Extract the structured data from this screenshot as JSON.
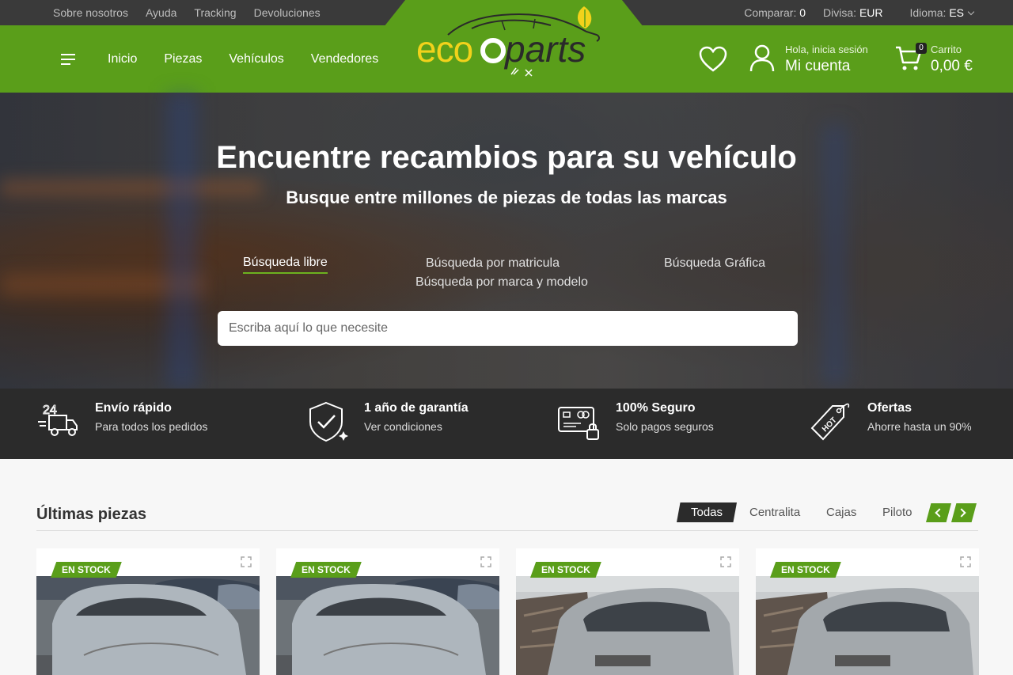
{
  "topbar": {
    "links": [
      "Sobre nosotros",
      "Ayuda",
      "Tracking",
      "Devoluciones"
    ],
    "compare_label": "Comparar:",
    "compare_value": "0",
    "currency_label": "Divisa:",
    "currency_value": "EUR",
    "language_label": "Idioma:",
    "language_value": "ES"
  },
  "header": {
    "nav": [
      "Inicio",
      "Piezas",
      "Vehículos",
      "Vendedores"
    ],
    "logo_text": "ecooparts",
    "account_small": "Hola, inicia sesión",
    "account_big": "Mi cuenta",
    "cart_count": "0",
    "cart_small": "Carrito",
    "cart_total": "0,00 €"
  },
  "hero": {
    "title": "Encuentre recambios para su vehículo",
    "subtitle": "Busque entre millones de piezas de todas las marcas",
    "tabs": [
      "Búsqueda libre",
      "Búsqueda por matricula",
      "Búsqueda por marca y modelo",
      "Búsqueda Gráfica"
    ],
    "search_placeholder": "Escriba aquí lo que necesite"
  },
  "features": [
    {
      "title": "Envío rápido",
      "subtitle": "Para todos los pedidos",
      "icon": "truck-24h-icon"
    },
    {
      "title": "1 año de garantía",
      "subtitle": "Ver condiciones",
      "icon": "shield-check-icon"
    },
    {
      "title": "100% Seguro",
      "subtitle": "Solo pagos seguros",
      "icon": "secure-card-icon"
    },
    {
      "title": "Ofertas",
      "subtitle": "Ahorre hasta un 90%",
      "icon": "hot-tag-icon"
    }
  ],
  "latest": {
    "title": "Últimas piezas",
    "filters": [
      "Todas",
      "Centralita",
      "Cajas",
      "Piloto"
    ],
    "badge": "EN STOCK"
  },
  "colors": {
    "brand_green": "#5a9e1a",
    "logo_yellow": "#f2d21b",
    "dark": "#2b2b2b"
  }
}
